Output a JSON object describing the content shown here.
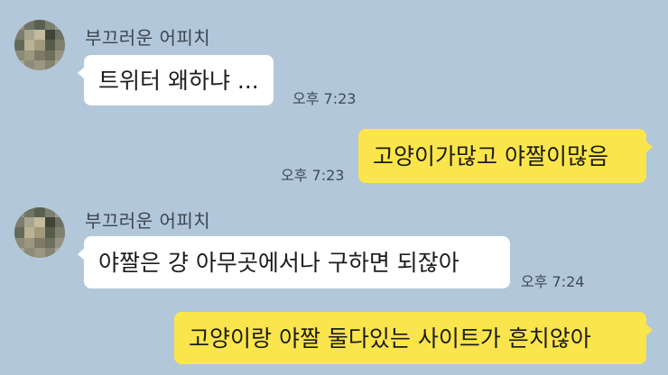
{
  "colors": {
    "background": "#b2c7da",
    "incoming_bubble": "#ffffff",
    "outgoing_bubble": "#fbe54d"
  },
  "messages": [
    {
      "direction": "incoming",
      "sender": "부끄러운 어피치",
      "text": "트위터 왜하냐 ...",
      "time": "오후 7:23"
    },
    {
      "direction": "outgoing",
      "text": "고양이가많고 야짤이많음",
      "time": "오후 7:23"
    },
    {
      "direction": "incoming",
      "sender": "부끄러운 어피치",
      "text": "야짤은 걍 아무곳에서나 구하면 되잖아",
      "time": "오후 7:24"
    },
    {
      "direction": "outgoing",
      "text": "고양이랑 야짤 둘다있는 사이트가 흔치않아"
    }
  ]
}
